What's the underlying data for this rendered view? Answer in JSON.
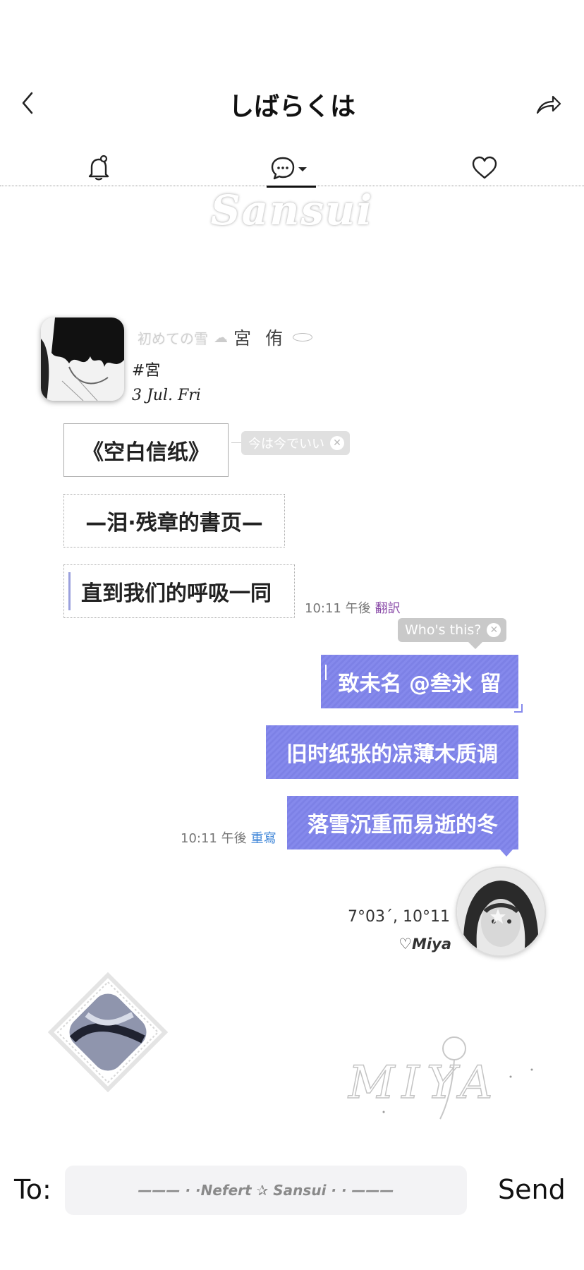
{
  "header": {
    "title": "しばらくは"
  },
  "tabs": [
    {
      "name": "notifications"
    },
    {
      "name": "chat",
      "active": true
    },
    {
      "name": "favorites"
    }
  ],
  "watermark": "Sansui",
  "profile": {
    "faint_label": "初めての雪",
    "name": "宮 侑",
    "tag": "#宮",
    "date": "3 Jul. Fri"
  },
  "left_messages": [
    {
      "text": "《空白信纸》"
    },
    {
      "text": "—泪·残章的書页—"
    },
    {
      "text": "直到我们的呼吸一同"
    }
  ],
  "left_pill": {
    "label": "今は今でいい"
  },
  "left_meta": {
    "time": "10:11 午後",
    "action": "翻訳"
  },
  "right_pill": {
    "label": "Who's this?"
  },
  "right_messages": [
    {
      "text": "致未名 @叁氷 留"
    },
    {
      "text": "旧时纸张的凉薄木质调"
    },
    {
      "text": "落雪沉重而易逝的冬"
    }
  ],
  "right_meta": {
    "time": "10:11 午後",
    "action": "重寫"
  },
  "footer_profile": {
    "coords": "7°03´, 10°11",
    "signature": "♡Miya"
  },
  "logo_text": "MIYA",
  "composer": {
    "to_label": "To:",
    "text": "——— · ·Nefert ✰ Sansui · · ———",
    "send_label": "Send"
  },
  "colors": {
    "bubble_purple": "#8589ec",
    "translate_link": "#8a4ba8",
    "rewrite_link": "#3f86d8"
  }
}
